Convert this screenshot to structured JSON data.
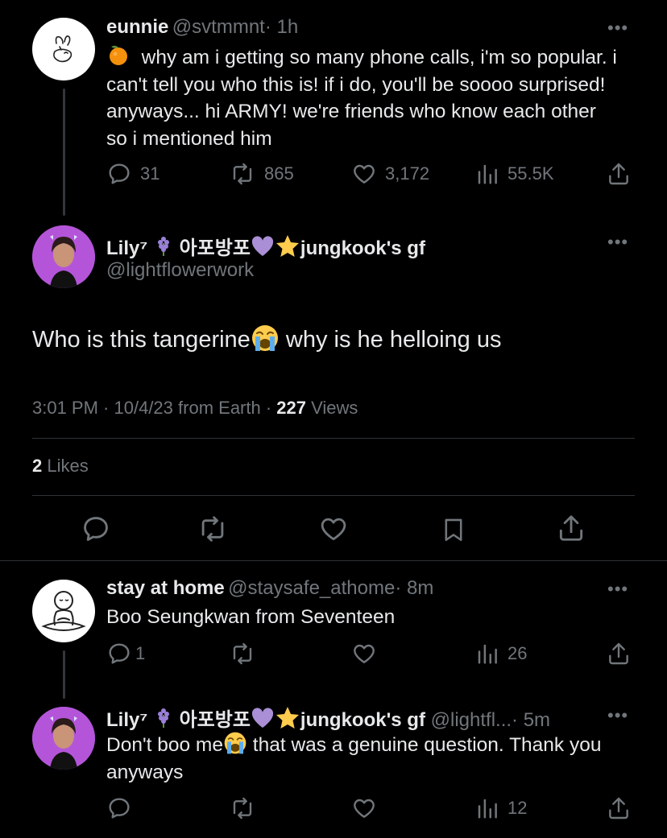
{
  "tweet1": {
    "name": "eunnie",
    "handle": "@svtmmnt",
    "time": "· 1h",
    "text": "why am i getting so many phone calls, i'm so popular. i can't tell you who this is! if i do, you'll be soooo surprised! anyways... hi ARMY! we're friends who know each other so i mentioned him",
    "replies": "31",
    "retweets": "865",
    "likes": "3,172",
    "views": "55.5K"
  },
  "main": {
    "name": "Lily⁷",
    "name_korean": "아포방포",
    "name_suffix": "jungkook's gf",
    "handle": "@lightflowerwork",
    "text_before": "Who is this tangerine",
    "text_after": "why is he helloing us",
    "time": "3:01 PM",
    "date": "10/4/23",
    "source": "from Earth",
    "views_count": "227",
    "views_label": "Views",
    "likes_count": "2",
    "likes_label": "Likes"
  },
  "reply1": {
    "name": "stay at home",
    "handle": "@staysafe_athome",
    "time": "· 8m",
    "text": "Boo Seungkwan from Seventeen",
    "replies": "1",
    "views": "26"
  },
  "reply2": {
    "name": "Lily⁷",
    "name_korean": "아포방포",
    "name_suffix": "jungkook's gf",
    "handle": "@lightfl...",
    "time": "· 5m",
    "text_before": "Don't boo me",
    "text_after": "that was a genuine question. Thank you anyways",
    "views": "12"
  },
  "more_label": "•••",
  "icons": [
    "reply-icon",
    "retweet-icon",
    "like-icon",
    "views-icon",
    "share-icon",
    "bookmark-icon",
    "tangerine-emoji",
    "crying-face-emoji",
    "hyacinth-emoji",
    "purple-heart-emoji",
    "star-emoji"
  ],
  "colors": {
    "background": "#000000",
    "text": "#e7e9ea",
    "muted": "#71767b",
    "divider": "#2f3336"
  }
}
